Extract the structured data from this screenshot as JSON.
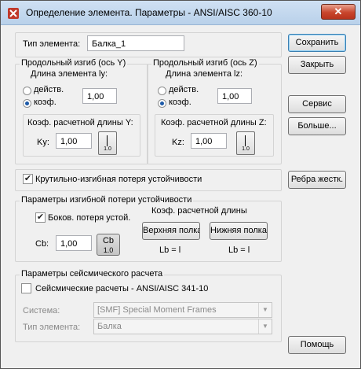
{
  "window": {
    "title": "Определение элемента. Параметры - ANSI/AISC 360-10",
    "close": "✕"
  },
  "element_type": {
    "label": "Тип элемента:",
    "value": "Балка_1"
  },
  "buckling_y": {
    "title": "Продольный изгиб (ось Y)",
    "length_label": "Длина элемента ly:",
    "opt_actual": "действ.",
    "opt_coef": "коэф.",
    "value": "1,00",
    "k_title": "Коэф. расчетной длины Y:",
    "k_label": "Ky:",
    "k_value": "1,00",
    "k_btn_value": "1.0"
  },
  "buckling_z": {
    "title": "Продольный изгиб (ось Z)",
    "length_label": "Длина элемента lz:",
    "opt_actual": "действ.",
    "opt_coef": "коэф.",
    "value": "1,00",
    "k_title": "Коэф. расчетной длины Z:",
    "k_label": "Kz:",
    "k_value": "1,00",
    "k_btn_value": "1.0"
  },
  "lateral_torsional": {
    "label": "Крутильно-изгибная потеря устойчивости",
    "checked": true
  },
  "ltb_params": {
    "title": "Параметры изгибной потери устойчивости",
    "side_label": "Боков. потеря устой.",
    "side_checked": true,
    "k_title": "Коэф. расчетной длины",
    "cb_label": "Cb:",
    "cb_value": "1,00",
    "cb_btn_top": "Cb",
    "cb_btn_bottom": "1.0",
    "top_flange": "Верхняя полка",
    "bottom_flange": "Нижняя полка",
    "lb_top": "Lb = l",
    "lb_bottom": "Lb = l"
  },
  "seismic": {
    "title": "Параметры сейсмического расчета",
    "check_label": "Сейсмические расчеты - ANSI/AISC  341-10",
    "checked": false,
    "system_label": "Система:",
    "system_value": "[SMF] Special Moment Frames",
    "type_label": "Тип элемента:",
    "type_value": "Балка"
  },
  "buttons": {
    "save": "Сохранить",
    "close": "Закрыть",
    "service": "Сервис",
    "more": "Больше...",
    "stiffeners": "Ребра жестк.",
    "help": "Помощь"
  }
}
